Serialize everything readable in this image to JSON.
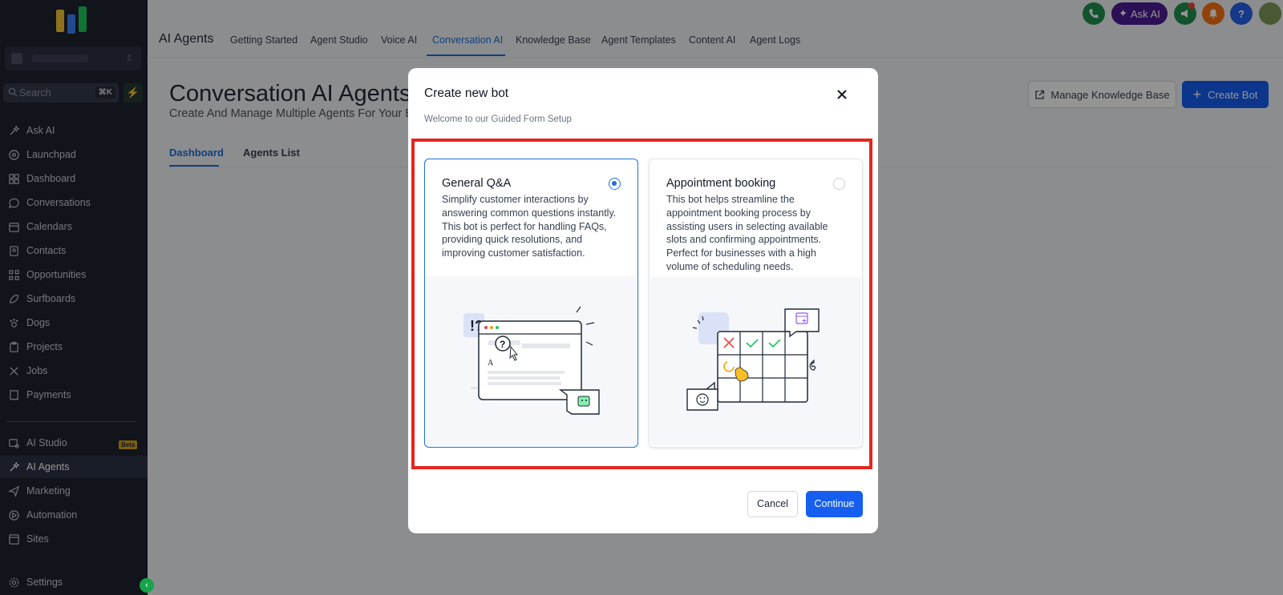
{
  "sidebar": {
    "search_placeholder": "Search",
    "search_shortcut": "⌘K",
    "items": [
      {
        "label": "Ask AI",
        "icon": "sparkle-icon"
      },
      {
        "label": "Launchpad",
        "icon": "rocket-icon"
      },
      {
        "label": "Dashboard",
        "icon": "grid-icon"
      },
      {
        "label": "Conversations",
        "icon": "chat-icon"
      },
      {
        "label": "Calendars",
        "icon": "calendar-icon"
      },
      {
        "label": "Contacts",
        "icon": "contacts-icon"
      },
      {
        "label": "Opportunities",
        "icon": "funnel-icon"
      },
      {
        "label": "Surfboards",
        "icon": "surfboard-icon"
      },
      {
        "label": "Dogs",
        "icon": "paw-icon"
      },
      {
        "label": "Projects",
        "icon": "clipboard-icon"
      },
      {
        "label": "Jobs",
        "icon": "tools-icon"
      },
      {
        "label": "Payments",
        "icon": "receipt-icon"
      }
    ],
    "bottom_items": [
      {
        "label": "AI Studio",
        "icon": "studio-icon"
      },
      {
        "label": "AI Agents",
        "icon": "sparkle-icon",
        "active": true
      },
      {
        "label": "Marketing",
        "icon": "send-icon"
      },
      {
        "label": "Automation",
        "icon": "automation-icon"
      },
      {
        "label": "Sites",
        "icon": "sites-icon"
      }
    ],
    "beta_badge": "Beta",
    "settings_label": "Settings"
  },
  "header": {
    "app_title": "AI Agents",
    "tabs": [
      "Getting Started",
      "Agent Studio",
      "Voice AI",
      "Conversation AI",
      "Knowledge Base",
      "Agent Templates",
      "Content AI",
      "Agent Logs"
    ],
    "active_tab": "Conversation AI",
    "ask_ai_label": "Ask AI",
    "help_label": "?"
  },
  "page": {
    "title": "Conversation AI Agents",
    "subtitle": "Create And Manage Multiple Agents For Your Business",
    "tabs": [
      "Dashboard",
      "Agents List"
    ],
    "manage_kb_label": "Manage Knowledge Base",
    "create_bot_label": "Create Bot"
  },
  "modal": {
    "title": "Create new bot",
    "subtitle": "Welcome to our Guided Form Setup",
    "options": [
      {
        "title": "General Q&A",
        "description": "Simplify customer interactions by answering common questions instantly. This bot is perfect for handling FAQs, providing quick resolutions, and improving customer satisfaction.",
        "selected": true
      },
      {
        "title": "Appointment booking",
        "description": "This bot helps streamline the appointment booking process by assisting users in selecting available slots and confirming appointments. Perfect for businesses with a high volume of scheduling needs.",
        "selected": false
      }
    ],
    "cancel_label": "Cancel",
    "continue_label": "Continue"
  },
  "colors": {
    "accent": "#155eef",
    "sidebar_bg": "#1f2430",
    "highlight": "#e3261f",
    "phone_btn": "#1f8f4e",
    "ask_ai_btn": "#4c1d95",
    "notif_btn": "#f97316"
  }
}
